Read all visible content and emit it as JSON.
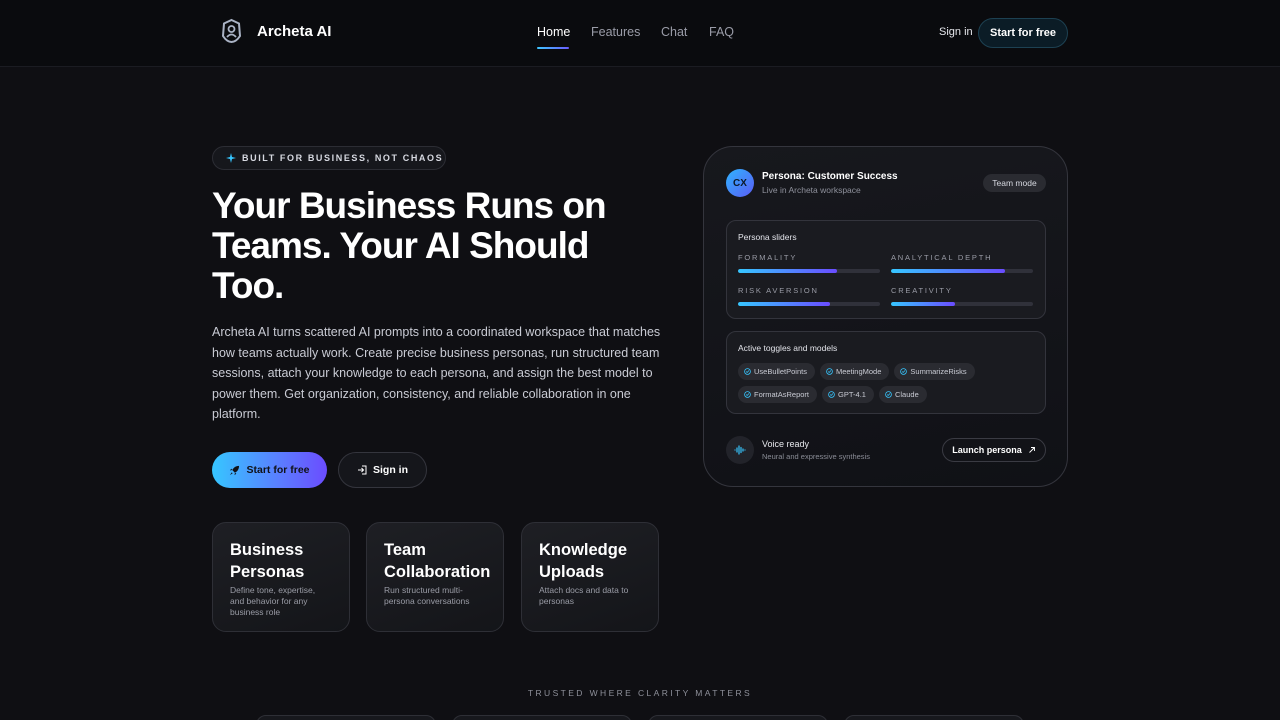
{
  "nav": {
    "brand": "Archeta AI",
    "links": [
      "Home",
      "Features",
      "Chat",
      "FAQ"
    ],
    "active": "Home",
    "signin": "Sign in",
    "cta": "Start for free"
  },
  "hero": {
    "eyebrow": "BUILT FOR BUSINESS, NOT CHAOS",
    "title": "Your Business Runs on Teams. Your AI Should Too.",
    "description": "Archeta AI turns scattered AI prompts into a coordinated workspace that matches how teams actually work. Create precise business personas, run structured team sessions, attach your knowledge to each persona, and assign the best model to power them. Get organization, consistency, and reliable collaboration in one platform.",
    "primary_button": "Start for free",
    "secondary_button": "Sign in"
  },
  "features": [
    {
      "title": "Business Personas",
      "desc": "Define tone, expertise, and behavior for any business role"
    },
    {
      "title": "Team Collaboration",
      "desc": "Run structured multi-persona conversations"
    },
    {
      "title": "Knowledge Uploads",
      "desc": "Attach docs and data to personas"
    }
  ],
  "panel": {
    "avatar": "CX",
    "persona_name": "Persona: Customer Success",
    "persona_sub": "Live in Archeta workspace",
    "badge": "Team mode",
    "sliders_title": "Persona sliders",
    "sliders": [
      {
        "label": "FORMALITY",
        "value": 0.7
      },
      {
        "label": "ANALYTICAL DEPTH",
        "value": 0.8
      },
      {
        "label": "RISK AVERSION",
        "value": 0.65
      },
      {
        "label": "CREATIVITY",
        "value": 0.45
      }
    ],
    "toggles_title": "Active toggles and models",
    "toggles": [
      "UseBulletPoints",
      "MeetingMode",
      "SummarizeRisks",
      "FormatAsReport",
      "GPT-4.1",
      "Claude"
    ],
    "voice_title": "Voice ready",
    "voice_sub": "Neural and expressive synthesis",
    "launch": "Launch persona"
  },
  "trusted": "TRUSTED WHERE CLARITY MATTERS",
  "colors": {
    "accent_start": "#36c6ff",
    "accent_end": "#6a4cff",
    "background": "#0f0f13"
  }
}
